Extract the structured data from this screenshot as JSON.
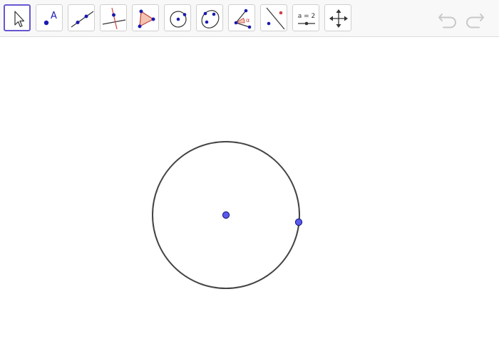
{
  "toolbar": {
    "tools": [
      {
        "name": "move",
        "icon": "arrow-cursor-icon",
        "selected": true
      },
      {
        "name": "point",
        "icon": "point-icon",
        "label": "A",
        "selected": false
      },
      {
        "name": "line",
        "icon": "line-icon",
        "selected": false
      },
      {
        "name": "perpendicular-line",
        "icon": "perpendicular-line-icon",
        "selected": false
      },
      {
        "name": "polygon",
        "icon": "polygon-icon",
        "selected": false
      },
      {
        "name": "circle-center-point",
        "icon": "circle-center-point-icon",
        "selected": false
      },
      {
        "name": "ellipse",
        "icon": "ellipse-icon",
        "selected": false
      },
      {
        "name": "angle",
        "icon": "angle-icon",
        "label": "α",
        "selected": false
      },
      {
        "name": "reflect-about-line",
        "icon": "reflect-icon",
        "selected": false
      },
      {
        "name": "slider",
        "icon": "slider-icon",
        "label": "a = 2",
        "selected": false
      },
      {
        "name": "move-graphics-view",
        "icon": "move-graphics-view-icon",
        "selected": false
      }
    ],
    "undo_icon": "undo-icon",
    "redo_icon": "redo-icon"
  },
  "colors": {
    "selected_border": "#6557d2",
    "point_fill": "#5a5af0",
    "point_stroke": "#1a1a80",
    "circle_stroke": "#444444",
    "icon_blue": "#1a1ab0",
    "polygon_fill": "#f3c3b0",
    "polygon_stroke": "#c04040",
    "perp_red": "#d04040",
    "disabled_gray": "#c8c8c8"
  }
}
